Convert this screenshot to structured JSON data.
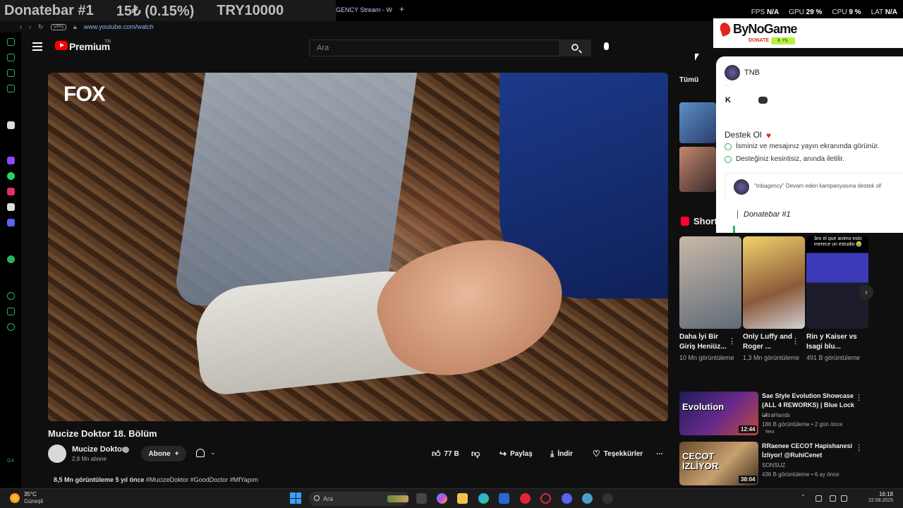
{
  "overlay_ticker": {
    "bar_name": "Donatebar #1",
    "amount": "15₺ (0.15%)",
    "goal": "TRY10000"
  },
  "browser": {
    "tab_title": "GENCY Stream - W",
    "vpn_label": "VPN",
    "url": "www.youtube.com/watch"
  },
  "perf": {
    "fps_label": "FPS",
    "fps_value": "N/A",
    "gpu_label": "GPU",
    "gpu_value": "29 %",
    "cpu_label": "CPU",
    "cpu_value": "9 %",
    "lat_label": "LAT",
    "lat_value": "N/A"
  },
  "youtube": {
    "logo_text": "Premium",
    "region": "TR",
    "search_placeholder": "Ara"
  },
  "video": {
    "channel_watermark": "FOX",
    "title": "Mucize Doktor 18. Bölüm",
    "channel_name": "Mucize Doktor",
    "subscribers": "2,8 Mn abone",
    "subscribe_label": "Abone",
    "likes": "77 B",
    "share_label": "Paylaş",
    "download_label": "İndir",
    "thanks_label": "Teşekkürler",
    "views_line": "8,5 Mn görüntüleme  5 yıl önce",
    "hashtags": "#MucizeDoktor #GoodDoctor #MfYapım"
  },
  "sidebar": {
    "chip_all": "Tümü",
    "shorts_title": "Shorts",
    "shorts": [
      {
        "title": "Daha İyi Bir Giriş Heniüz...",
        "views": "10 Mn görüntüleme"
      },
      {
        "title": "Only Luffy and Roger ...",
        "views": "1,3 Mn görüntüleme"
      },
      {
        "title": "Rin y Kaiser vs Isagi blu...",
        "views": "491 B görüntüleme",
        "caption": "bro el que animo esto merece un estudio 😭"
      }
    ],
    "videos": [
      {
        "title": "Sae Style Evolution Showcase (ALL 4 REWORKS) | Blue Lock ...",
        "channel": "UltraHands",
        "meta": "186 B görüntüleme • 2 gün önce",
        "badge": "Yeni",
        "duration": "12:44",
        "overlay": "Evolution"
      },
      {
        "title": "RRaenee CECOT Hapishanesi İzliyor! @RuhiCenet",
        "channel": "SONSUZ",
        "meta": "436 B görüntüleme • 6 ay önce",
        "duration": "38:04",
        "overlay": "CECOT İZLİYOR"
      }
    ]
  },
  "bynogame": {
    "brand": "ByNoGame",
    "donate_label": "DONATE",
    "badge": "8. YIL",
    "user": "TNB",
    "support_title": "Destek Ol",
    "benefits": [
      "İsminiz ve mesajınız yayın ekranında görünür.",
      "Desteğiniz kesintisiz, anında iletilir."
    ],
    "message": "\"tnbagency\" Devam eden kampanyasına destek ol!",
    "bar_label": "Donatebar #1"
  },
  "taskbar": {
    "weather_temp": "35°C",
    "weather_text": "Güneşli",
    "search_placeholder": "Ara",
    "time": "16:18",
    "date": "22.08.2025"
  },
  "colors": {
    "accent_red": "#ff0000",
    "bng_red": "#e0261a",
    "bng_green": "#2db35d"
  }
}
